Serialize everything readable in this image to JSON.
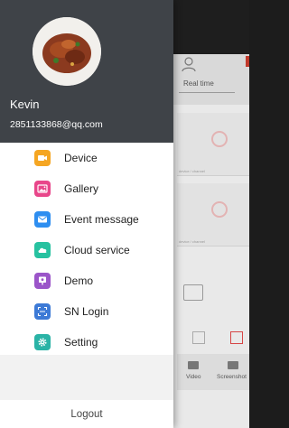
{
  "background_app": {
    "tab_label": "Real time",
    "channel_label": "device / channel",
    "bottom_bar": {
      "video_label": "Video",
      "screenshot_label": "Screenshot"
    }
  },
  "drawer": {
    "user": {
      "name": "Kevin",
      "email": "2851133868@qq.com"
    },
    "menu": [
      {
        "label": "Device",
        "icon": "video-camera-icon",
        "color": "#f5a623"
      },
      {
        "label": "Gallery",
        "icon": "image-icon",
        "color": "#e8468a"
      },
      {
        "label": "Event message",
        "icon": "envelope-icon",
        "color": "#2e8ef0"
      },
      {
        "label": "Cloud service",
        "icon": "cloud-icon",
        "color": "#27c2a0"
      },
      {
        "label": "Demo",
        "icon": "demo-screen-icon",
        "color": "#9b55c9"
      },
      {
        "label": "SN Login",
        "icon": "scan-icon",
        "color": "#3d7ad6"
      },
      {
        "label": "Setting",
        "icon": "gear-icon",
        "color": "#2ab3a6"
      }
    ],
    "logout_label": "Logout"
  }
}
